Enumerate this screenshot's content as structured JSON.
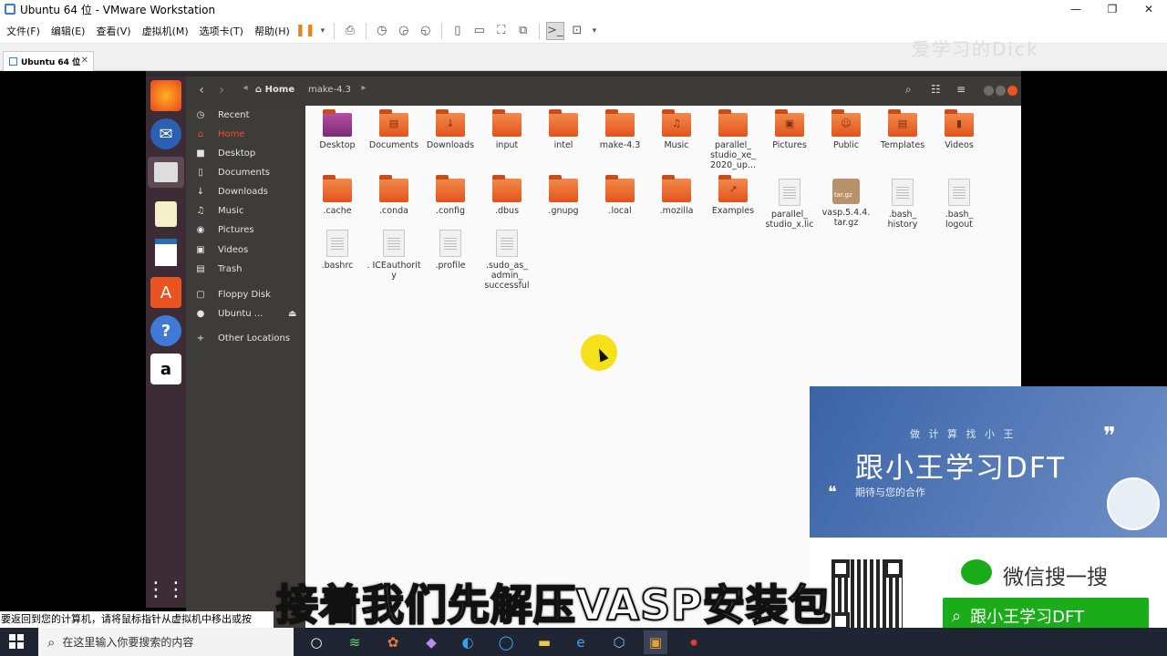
{
  "window": {
    "title": "Ubuntu 64 位 - VMware Workstation",
    "minimize": "—",
    "maximize": "❐",
    "close": "✕"
  },
  "menu": [
    "文件(F)",
    "编辑(E)",
    "查看(V)",
    "虚拟机(M)",
    "选项卡(T)",
    "帮助(H)"
  ],
  "tab": {
    "label": "Ubuntu 64 位",
    "close": "✕"
  },
  "watermark": "爱学习的Dick",
  "files_header": {
    "home": "Home",
    "folder": "make-4.3"
  },
  "sidebar": [
    {
      "label": "Recent",
      "icon": "clock-icon",
      "glyph": "◷"
    },
    {
      "label": "Home",
      "icon": "home-icon",
      "glyph": "⌂",
      "active": true
    },
    {
      "label": "Desktop",
      "icon": "folder-icon",
      "glyph": "■"
    },
    {
      "label": "Documents",
      "icon": "document-icon",
      "glyph": "▯"
    },
    {
      "label": "Downloads",
      "icon": "download-icon",
      "glyph": "↓"
    },
    {
      "label": "Music",
      "icon": "music-icon",
      "glyph": "♫"
    },
    {
      "label": "Pictures",
      "icon": "camera-icon",
      "glyph": "◉"
    },
    {
      "label": "Videos",
      "icon": "film-icon",
      "glyph": "▣"
    },
    {
      "label": "Trash",
      "icon": "trash-icon",
      "glyph": "▤"
    },
    {
      "label": "Floppy Disk",
      "icon": "disk-icon",
      "glyph": "▢"
    },
    {
      "label": "Ubuntu ...",
      "icon": "disc-icon",
      "glyph": "●"
    },
    {
      "label": "Other Locations",
      "icon": "plus-icon",
      "glyph": "+"
    }
  ],
  "files_row1": [
    "Desktop",
    "Documents",
    "Downloads",
    "input",
    "intel",
    "make-4.3",
    "Music",
    "parallel_ studio_xe_ 2020_up...",
    "Pictures",
    "Public",
    "Templates",
    "Videos"
  ],
  "files_row2": [
    ".cache",
    ".conda",
    ".config",
    ".dbus",
    ".gnupg",
    ".local",
    ".mozilla",
    "Examples",
    "parallel_ studio_x.lic",
    "vasp.5.4.4. tar.gz",
    ".bash_ history",
    ".bash_ logout"
  ],
  "files_row3": [
    ".bashrc",
    ". ICEauthorit y",
    ".profile",
    ".sudo_as_ admin_ successful"
  ],
  "tgz_badge": "tar.gz",
  "ad": {
    "tagline": "做 计 算 找 小 王",
    "title": "跟小王学习DFT",
    "subtitle": "期待与您的合作",
    "wechat": "微信搜一搜",
    "search_btn": "跟小王学习DFT"
  },
  "status_text": "要返回到您的计算机，请将鼠标指针从虚拟机中移出或按 Ctrl+Alt。",
  "subtitle": "接着我们先解压VASP安装包",
  "taskbar": {
    "search_placeholder": "在这里输入你要搜索的内容"
  }
}
